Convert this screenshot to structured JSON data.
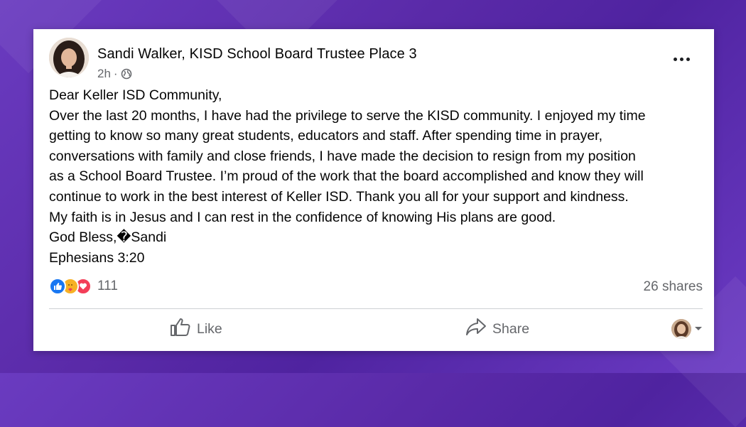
{
  "post": {
    "author": "Sandi Walker, KISD School Board Trustee Place 3",
    "time": "2h",
    "separator": "·",
    "privacy_icon": "globe-icon",
    "more_icon": "more-options-icon",
    "body_lines": [
      "Dear Keller ISD Community,",
      "Over the last 20 months, I have had the privilege to serve the KISD community. I enjoyed my time",
      "getting to know so many great students, educators and staff. After spending time in prayer,",
      "conversations with family and close friends, I have made the decision to resign from my position",
      "as a School Board Trustee. I’m proud of the work that the board accomplished and know they will",
      "continue to work in the best interest of Keller ISD. Thank you all for your support and kindness.",
      "My faith is in Jesus and I can rest in the confidence of knowing His plans are good.",
      "God Bless,�Sandi",
      "Ephesians 3:20"
    ]
  },
  "engagement": {
    "reaction_icons": [
      "like-icon",
      "care-icon",
      "love-icon"
    ],
    "reaction_count": "111",
    "shares": "26 shares"
  },
  "actions": {
    "like_label": "Like",
    "share_label": "Share"
  },
  "colors": {
    "background": "#5a2aa8",
    "facebook_blue": "#1877f2",
    "love_red": "#f33e58",
    "care_yellow": "#f7b125",
    "secondary_text": "#65676b"
  }
}
